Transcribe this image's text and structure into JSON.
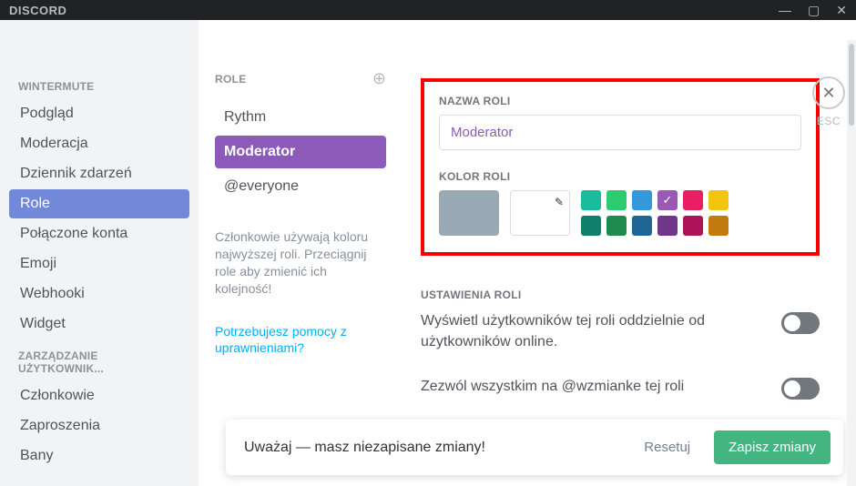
{
  "titlebar": {
    "brand": "DISCORD"
  },
  "sidebar": {
    "sections": [
      {
        "heading": "WINTERMUTE",
        "items": [
          {
            "label": "Podgląd",
            "active": false
          },
          {
            "label": "Moderacja",
            "active": false
          },
          {
            "label": "Dziennik zdarzeń",
            "active": false
          },
          {
            "label": "Role",
            "active": true
          },
          {
            "label": "Połączone konta",
            "active": false
          },
          {
            "label": "Emoji",
            "active": false
          },
          {
            "label": "Webhooki",
            "active": false
          },
          {
            "label": "Widget",
            "active": false
          }
        ]
      },
      {
        "heading": "ZARZĄDZANIE UŻYTKOWNIK...",
        "items": [
          {
            "label": "Członkowie",
            "active": false
          },
          {
            "label": "Zaproszenia",
            "active": false
          },
          {
            "label": "Bany",
            "active": false
          }
        ]
      }
    ]
  },
  "roles_col": {
    "header": "ROLE",
    "items": [
      {
        "label": "Rythm",
        "selected": false
      },
      {
        "label": "Moderator",
        "selected": true
      },
      {
        "label": "@everyone",
        "selected": false
      }
    ],
    "note": "Członkowie używają koloru najwyższej roli. Przeciągnij role aby zmienić ich kolejność!",
    "help": "Potrzebujesz pomocy z uprawnieniami?"
  },
  "main": {
    "name_label": "NAZWA ROLI",
    "name_value": "Moderator",
    "color_label": "KOLOR ROLI",
    "colors_row1": [
      "#1abc9c",
      "#2ecc71",
      "#3498db",
      "#9b59b6",
      "#e91e63",
      "#f1c40f"
    ],
    "colors_row2": [
      "#11806a",
      "#1f8b4c",
      "#206694",
      "#71368a",
      "#ad1457",
      "#c27c0e"
    ],
    "selected_color_index_row1": 3,
    "settings_label": "USTAWIENIA ROLI",
    "setting1": "Wyświetl użytkowników tej roli oddzielnie od użytkowników online.",
    "setting2": "Zezwól wszystkim na @wzmianke tej roli"
  },
  "esc": {
    "label": "ESC"
  },
  "toast": {
    "text": "Uważaj — masz niezapisane zmiany!",
    "reset": "Resetuj",
    "save": "Zapisz zmiany"
  }
}
